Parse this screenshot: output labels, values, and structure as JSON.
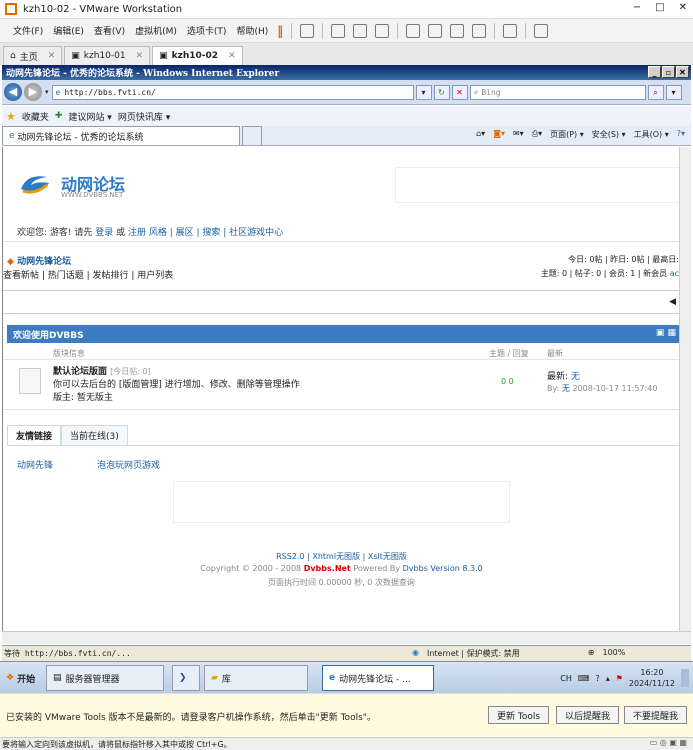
{
  "vmware": {
    "title": "kzh10-02 - VMware Workstation",
    "window_controls": [
      "−",
      "□",
      "✕"
    ],
    "menu": [
      "文件(F)",
      "编辑(E)",
      "查看(V)",
      "虚拟机(M)",
      "选项卡(T)",
      "帮助(H)"
    ],
    "tabs": [
      {
        "label": "主页",
        "icon": "home-icon",
        "active": false
      },
      {
        "label": "kzh10-01",
        "icon": "vm-icon",
        "active": false
      },
      {
        "label": "kzh10-02",
        "icon": "vm-icon",
        "active": true
      }
    ],
    "notice": "已安装的 VMware Tools 版本不是最新的。请登录客户机操作系统，然后单击\"更新 Tools\"。",
    "notice_buttons": [
      "更新 Tools",
      "以后提醒我",
      "不要提醒我"
    ],
    "statusbar": "要将输入定向到该虚拟机，请将鼠标指针移入其中或按 Ctrl+G。"
  },
  "ie": {
    "title": "动网先锋论坛 - 优秀的论坛系统 - Windows Internet Explorer",
    "address": "http://bbs.fvti.cn/",
    "search_placeholder": "Bing",
    "favorites_label": "收藏夹",
    "fav_links": [
      "建议网站 ▾",
      "网页快讯库 ▾"
    ],
    "tab_title": "动网先锋论坛 - 优秀的论坛系统",
    "commands": [
      "页面(P) ▾",
      "安全(S) ▾",
      "工具(O) ▾"
    ],
    "status_url": "等待 http://bbs.fvti.cn/...",
    "status_zone": "Internet | 保护模式: 禁用",
    "zoom": "100%"
  },
  "forum": {
    "logo_name": "动网论坛",
    "logo_sub": "WWW.DVBBS.NET",
    "welcome_prefix": "欢迎您: 游客! 请先",
    "login": "登录",
    "or": "或",
    "register": "注册",
    "menu_links": "风格 | 展区 | 搜索 | 社区游戏中心",
    "forum_name": "动网先锋论坛",
    "nav_links": "查看新帖 | 热门话题 | 发帖排行 | 用户列表",
    "stats_line1": "今日: 0帖 | 昨日: 0帖 | 最高日:",
    "stats_line2_prefix": "主题: 0 | 帖子: 0 | 会员: 1 | 新会员",
    "stats_line2_link": "ac",
    "section_title": "欢迎使用DVBBS",
    "col_board": "版块信息",
    "col_topics": "主题 / 回复",
    "col_last": "最新",
    "board_title": "默认论坛版面",
    "board_today": "[今日帖: 0]",
    "board_desc": "你可以去后台的 [版面管理] 进行增加、修改、删除等管理操作",
    "board_mod": "版主: 暂无版主",
    "board_counts": "0  0",
    "last_label": "最新:",
    "last_value": "无",
    "by_label": "By:",
    "by_value": "无",
    "by_time": "2008-10-17 11:57:40",
    "bottom_tabs": [
      "友情链接",
      "当前在线(3)"
    ],
    "friend_links": [
      "动网先锋",
      "泡泡玩网页游戏"
    ],
    "footer_links": "RSS2.0 | Xhtml无图版 | Xslt无图版",
    "copyright_prefix": "Copyright © 2000 - 2008",
    "copyright_brand": "Dvbbs.Net",
    "powered_prefix": "Powered By",
    "powered_brand": "Dvbbs Version 8.3.0",
    "exec_time": "页面执行时间 0.00000 秒, 0 次数据查询"
  },
  "taskbar": {
    "start": "开始",
    "items": [
      "服务器管理器",
      "",
      "库",
      "动网先锋论坛 - ..."
    ],
    "lang": "CH",
    "time": "16:20",
    "date": "2024/11/12"
  }
}
